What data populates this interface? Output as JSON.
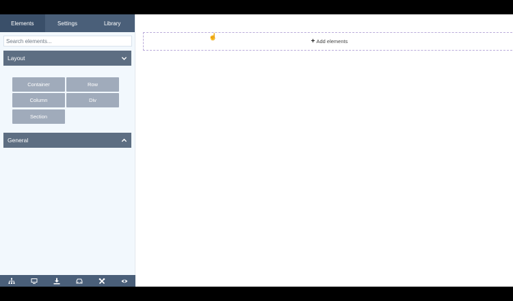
{
  "sidebar": {
    "tabs": [
      {
        "label": "Elements"
      },
      {
        "label": "Settings"
      },
      {
        "label": "Library"
      }
    ],
    "search": {
      "placeholder": "Search elements..."
    },
    "layout_panel": {
      "title": "Layout",
      "state": "expanded",
      "elements": [
        {
          "label": "Container"
        },
        {
          "label": "Row"
        },
        {
          "label": "Column"
        },
        {
          "label": "Div"
        },
        {
          "label": "Section"
        }
      ]
    },
    "general_panel": {
      "title": "General",
      "state": "collapsed"
    },
    "bottom_icons": [
      "sitemap-icon",
      "desktop-icon",
      "download-icon",
      "car-icon",
      "tools-icon",
      "eye-icon"
    ]
  },
  "canvas": {
    "add_elements_label": "Add elements"
  },
  "colors": {
    "tab_bar": "#4a5f79",
    "panel_header": "#5d6e82",
    "element_button": "#a0abbb",
    "sidebar_bg": "#f2f8fd",
    "dropzone_border": "#b8a9d9"
  }
}
